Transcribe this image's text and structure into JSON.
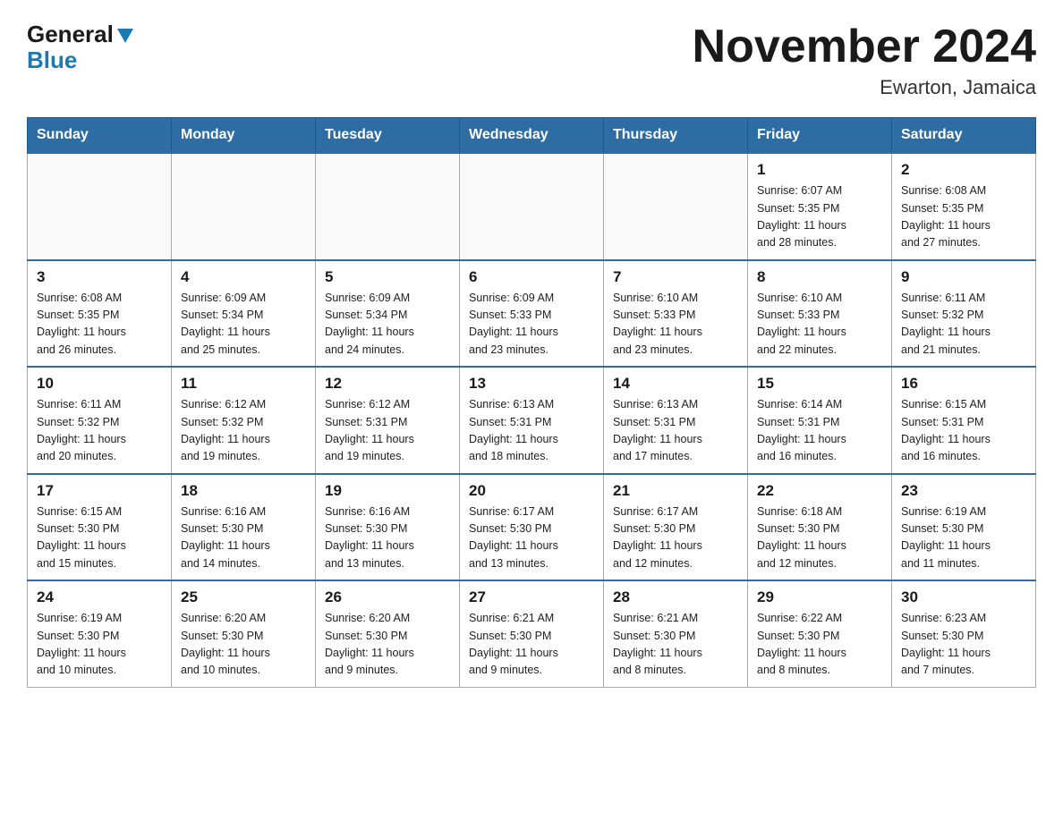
{
  "header": {
    "logo_general": "General",
    "logo_blue": "Blue",
    "main_title": "November 2024",
    "subtitle": "Ewarton, Jamaica"
  },
  "calendar": {
    "days_of_week": [
      "Sunday",
      "Monday",
      "Tuesday",
      "Wednesday",
      "Thursday",
      "Friday",
      "Saturday"
    ],
    "weeks": [
      [
        {
          "day": "",
          "info": ""
        },
        {
          "day": "",
          "info": ""
        },
        {
          "day": "",
          "info": ""
        },
        {
          "day": "",
          "info": ""
        },
        {
          "day": "",
          "info": ""
        },
        {
          "day": "1",
          "info": "Sunrise: 6:07 AM\nSunset: 5:35 PM\nDaylight: 11 hours\nand 28 minutes."
        },
        {
          "day": "2",
          "info": "Sunrise: 6:08 AM\nSunset: 5:35 PM\nDaylight: 11 hours\nand 27 minutes."
        }
      ],
      [
        {
          "day": "3",
          "info": "Sunrise: 6:08 AM\nSunset: 5:35 PM\nDaylight: 11 hours\nand 26 minutes."
        },
        {
          "day": "4",
          "info": "Sunrise: 6:09 AM\nSunset: 5:34 PM\nDaylight: 11 hours\nand 25 minutes."
        },
        {
          "day": "5",
          "info": "Sunrise: 6:09 AM\nSunset: 5:34 PM\nDaylight: 11 hours\nand 24 minutes."
        },
        {
          "day": "6",
          "info": "Sunrise: 6:09 AM\nSunset: 5:33 PM\nDaylight: 11 hours\nand 23 minutes."
        },
        {
          "day": "7",
          "info": "Sunrise: 6:10 AM\nSunset: 5:33 PM\nDaylight: 11 hours\nand 23 minutes."
        },
        {
          "day": "8",
          "info": "Sunrise: 6:10 AM\nSunset: 5:33 PM\nDaylight: 11 hours\nand 22 minutes."
        },
        {
          "day": "9",
          "info": "Sunrise: 6:11 AM\nSunset: 5:32 PM\nDaylight: 11 hours\nand 21 minutes."
        }
      ],
      [
        {
          "day": "10",
          "info": "Sunrise: 6:11 AM\nSunset: 5:32 PM\nDaylight: 11 hours\nand 20 minutes."
        },
        {
          "day": "11",
          "info": "Sunrise: 6:12 AM\nSunset: 5:32 PM\nDaylight: 11 hours\nand 19 minutes."
        },
        {
          "day": "12",
          "info": "Sunrise: 6:12 AM\nSunset: 5:31 PM\nDaylight: 11 hours\nand 19 minutes."
        },
        {
          "day": "13",
          "info": "Sunrise: 6:13 AM\nSunset: 5:31 PM\nDaylight: 11 hours\nand 18 minutes."
        },
        {
          "day": "14",
          "info": "Sunrise: 6:13 AM\nSunset: 5:31 PM\nDaylight: 11 hours\nand 17 minutes."
        },
        {
          "day": "15",
          "info": "Sunrise: 6:14 AM\nSunset: 5:31 PM\nDaylight: 11 hours\nand 16 minutes."
        },
        {
          "day": "16",
          "info": "Sunrise: 6:15 AM\nSunset: 5:31 PM\nDaylight: 11 hours\nand 16 minutes."
        }
      ],
      [
        {
          "day": "17",
          "info": "Sunrise: 6:15 AM\nSunset: 5:30 PM\nDaylight: 11 hours\nand 15 minutes."
        },
        {
          "day": "18",
          "info": "Sunrise: 6:16 AM\nSunset: 5:30 PM\nDaylight: 11 hours\nand 14 minutes."
        },
        {
          "day": "19",
          "info": "Sunrise: 6:16 AM\nSunset: 5:30 PM\nDaylight: 11 hours\nand 13 minutes."
        },
        {
          "day": "20",
          "info": "Sunrise: 6:17 AM\nSunset: 5:30 PM\nDaylight: 11 hours\nand 13 minutes."
        },
        {
          "day": "21",
          "info": "Sunrise: 6:17 AM\nSunset: 5:30 PM\nDaylight: 11 hours\nand 12 minutes."
        },
        {
          "day": "22",
          "info": "Sunrise: 6:18 AM\nSunset: 5:30 PM\nDaylight: 11 hours\nand 12 minutes."
        },
        {
          "day": "23",
          "info": "Sunrise: 6:19 AM\nSunset: 5:30 PM\nDaylight: 11 hours\nand 11 minutes."
        }
      ],
      [
        {
          "day": "24",
          "info": "Sunrise: 6:19 AM\nSunset: 5:30 PM\nDaylight: 11 hours\nand 10 minutes."
        },
        {
          "day": "25",
          "info": "Sunrise: 6:20 AM\nSunset: 5:30 PM\nDaylight: 11 hours\nand 10 minutes."
        },
        {
          "day": "26",
          "info": "Sunrise: 6:20 AM\nSunset: 5:30 PM\nDaylight: 11 hours\nand 9 minutes."
        },
        {
          "day": "27",
          "info": "Sunrise: 6:21 AM\nSunset: 5:30 PM\nDaylight: 11 hours\nand 9 minutes."
        },
        {
          "day": "28",
          "info": "Sunrise: 6:21 AM\nSunset: 5:30 PM\nDaylight: 11 hours\nand 8 minutes."
        },
        {
          "day": "29",
          "info": "Sunrise: 6:22 AM\nSunset: 5:30 PM\nDaylight: 11 hours\nand 8 minutes."
        },
        {
          "day": "30",
          "info": "Sunrise: 6:23 AM\nSunset: 5:30 PM\nDaylight: 11 hours\nand 7 minutes."
        }
      ]
    ]
  }
}
